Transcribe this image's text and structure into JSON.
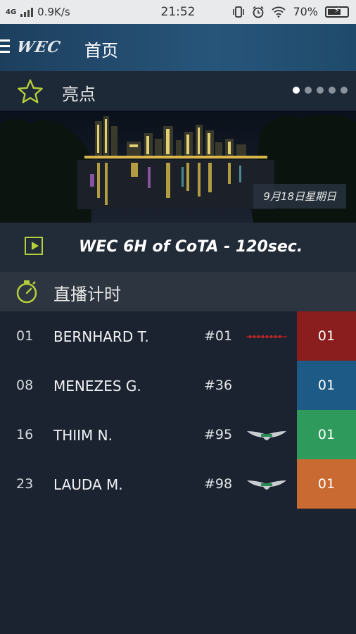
{
  "status_bar": {
    "network": "4G",
    "speed": "0.9K/s",
    "time": "21:52",
    "battery": "70%",
    "battery_level": 0.7
  },
  "app_bar": {
    "logo": "WEC",
    "title": "首页"
  },
  "highlights": {
    "title": "亮点",
    "page_count": 5,
    "active_page": 0,
    "date": "9月18日星期日",
    "video_title": "WEC 6H of CoTA - 120sec."
  },
  "live_timing": {
    "title": "直播计时",
    "rows": [
      {
        "pos": "01",
        "name": "BERNHARD T.",
        "car": "#01",
        "brand_icon": "porsche-logo-icon",
        "class_value": "01",
        "class_color": "#8a1d1d"
      },
      {
        "pos": "08",
        "name": "MENEZES G.",
        "car": "#36",
        "brand_icon": "",
        "class_value": "01",
        "class_color": "#1e5a86"
      },
      {
        "pos": "16",
        "name": "THIIM N.",
        "car": "#95",
        "brand_icon": "aston-martin-wings-icon",
        "class_value": "01",
        "class_color": "#2e9b5c"
      },
      {
        "pos": "23",
        "name": "LAUDA M.",
        "car": "#98",
        "brand_icon": "aston-martin-wings-icon",
        "class_value": "01",
        "class_color": "#c96a32"
      }
    ]
  },
  "colors": {
    "accent": "#b5cf3c",
    "background": "#1b2330"
  }
}
